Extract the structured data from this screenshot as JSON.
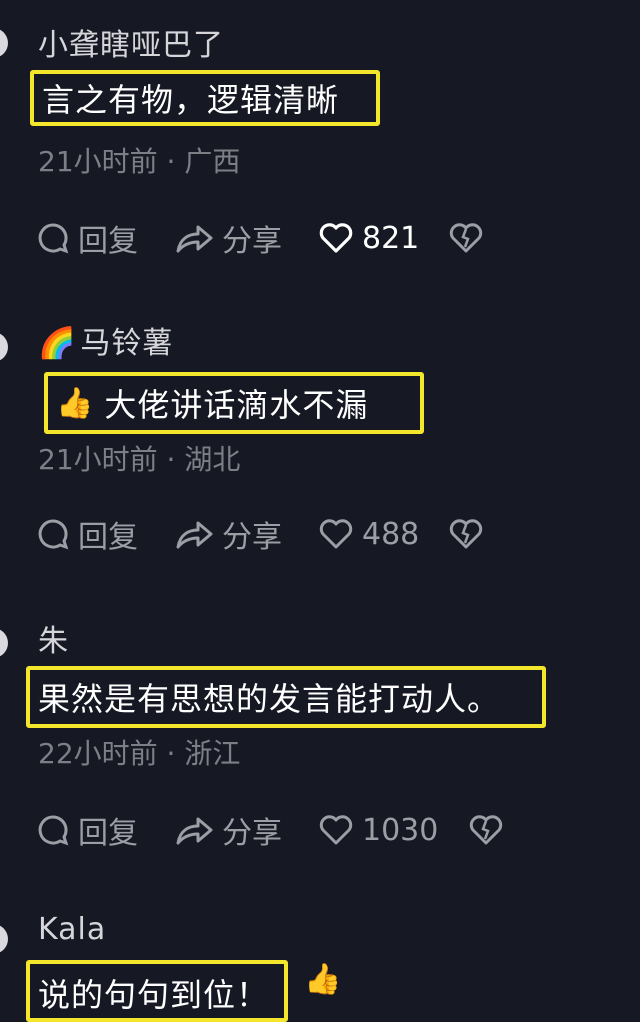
{
  "comments": [
    {
      "username": "小聋瞎哑巴了",
      "text": "言之有物，逻辑清晰",
      "meta": "21小时前 · 广西",
      "reply_label": "回复",
      "share_label": "分享",
      "likes": "821"
    },
    {
      "username": "马铃薯",
      "username_emoji": "🌈",
      "text": "大佬讲话滴水不漏",
      "text_emoji": "👍",
      "meta": "21小时前 · 湖北",
      "reply_label": "回复",
      "share_label": "分享",
      "likes": "488"
    },
    {
      "username": "朱",
      "text": "果然是有思想的发言能打动人。",
      "meta": "22小时前 · 浙江",
      "reply_label": "回复",
      "share_label": "分享",
      "likes": "1030"
    },
    {
      "username": "Kala",
      "text": "说的句句到位！",
      "text_emoji": "👍"
    }
  ],
  "colors": {
    "background": "#161823",
    "highlight_border": "#f3e62b",
    "meta_text": "#7d7f87"
  },
  "icons": [
    "comment-bubble-icon",
    "share-arrow-icon",
    "heart-icon",
    "broken-heart-icon"
  ]
}
